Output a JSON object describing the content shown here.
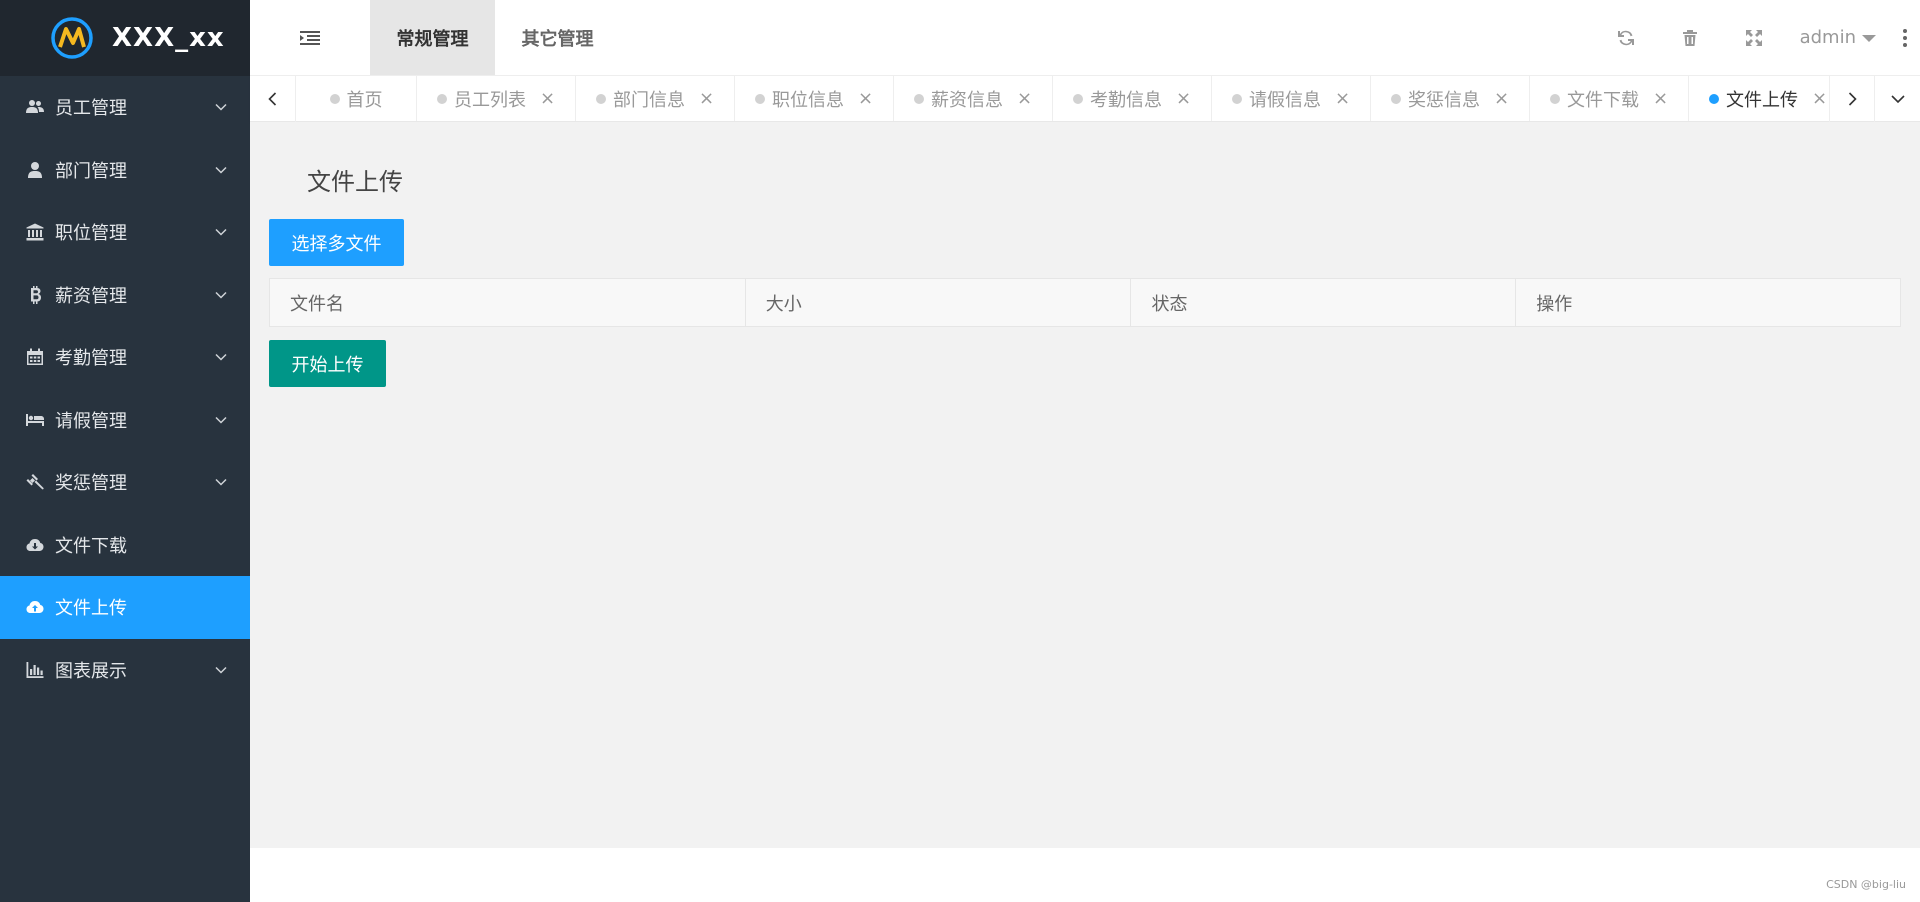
{
  "app": {
    "title": "XXX_xx"
  },
  "sidebar": {
    "items": [
      {
        "label": "员工管理",
        "icon": "users-icon",
        "has_submenu": true
      },
      {
        "label": "部门管理",
        "icon": "user-icon",
        "has_submenu": true
      },
      {
        "label": "职位管理",
        "icon": "institution-icon",
        "has_submenu": true
      },
      {
        "label": "薪资管理",
        "icon": "bitcoin-icon",
        "has_submenu": true
      },
      {
        "label": "考勤管理",
        "icon": "calendar-icon",
        "has_submenu": true
      },
      {
        "label": "请假管理",
        "icon": "bed-icon",
        "has_submenu": true
      },
      {
        "label": "奖惩管理",
        "icon": "gavel-icon",
        "has_submenu": true
      },
      {
        "label": "文件下载",
        "icon": "cloud-download-icon",
        "has_submenu": false
      },
      {
        "label": "文件上传",
        "icon": "cloud-upload-icon",
        "has_submenu": false,
        "active": true
      },
      {
        "label": "图表展示",
        "icon": "bar-chart-icon",
        "has_submenu": true
      }
    ]
  },
  "header": {
    "nav": [
      {
        "label": "常规管理",
        "active": true
      },
      {
        "label": "其它管理",
        "active": false
      }
    ],
    "user": "admin"
  },
  "tabs": [
    {
      "label": "首页",
      "closable": false
    },
    {
      "label": "员工列表",
      "closable": true
    },
    {
      "label": "部门信息",
      "closable": true
    },
    {
      "label": "职位信息",
      "closable": true
    },
    {
      "label": "薪资信息",
      "closable": true
    },
    {
      "label": "考勤信息",
      "closable": true
    },
    {
      "label": "请假信息",
      "closable": true
    },
    {
      "label": "奖惩信息",
      "closable": true
    },
    {
      "label": "文件下载",
      "closable": true
    },
    {
      "label": "文件上传",
      "closable": true,
      "active": true
    }
  ],
  "main": {
    "title": "文件上传",
    "select_button": "选择多文件",
    "upload_button": "开始上传",
    "table": {
      "columns": [
        "文件名",
        "大小",
        "状态",
        "操作"
      ],
      "rows": []
    }
  },
  "watermark": "CSDN @big-liu",
  "colors": {
    "sidebar_bg": "#28333e",
    "logo_bg": "#20272f",
    "accent": "#1e9fff",
    "upload_button": "#009688",
    "main_bg": "#f2f2f2"
  }
}
